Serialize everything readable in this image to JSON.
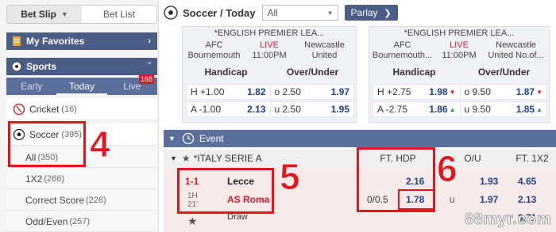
{
  "bet_tabs": {
    "bet_slip": "Bet Slip",
    "bet_list": "Bet List"
  },
  "favorites": {
    "label": "My Favorites"
  },
  "sports": {
    "label": "Sports"
  },
  "subtabs": {
    "early": "Early",
    "today": "Today",
    "live": "Live",
    "live_count": "168"
  },
  "categories": [
    {
      "label": "Cricket",
      "count": "(16)",
      "icon": "cricket-icon"
    },
    {
      "label": "Soccer",
      "count": "(395)",
      "icon": "soccer-ball-icon"
    }
  ],
  "soccer_sub": [
    {
      "label": "All",
      "count": "(350)"
    },
    {
      "label": "1X2",
      "count": "(266)"
    },
    {
      "label": "Correct Score",
      "count": "(226)"
    },
    {
      "label": "Odd/Even",
      "count": "(257)"
    }
  ],
  "annotations": {
    "n4": "4",
    "n5": "5",
    "n6": "6"
  },
  "topbar": {
    "title": "Soccer / Today",
    "filter": "All",
    "parlay": "Parlay"
  },
  "cards": [
    {
      "league": "*ENGLISH PREMIER LEA...",
      "home": "AFC Bournemouth",
      "home_l1": "AFC",
      "home_l2": "Bournemouth",
      "live": "LIVE",
      "time": "11:00PM",
      "away_l1": "Newcastle",
      "away_l2": "United",
      "handicap": "Handicap",
      "over_under": "Over/Under",
      "rows": [
        {
          "h_lbl": "H +1.00",
          "h_val": "1.82",
          "h_arrow": "",
          "ou_lbl": "o 2.50",
          "ou_val": "1.97",
          "ou_arrow": ""
        },
        {
          "h_lbl": "A -1.00",
          "h_val": "2.13",
          "h_arrow": "",
          "ou_lbl": "u 2.50",
          "ou_val": "1.95",
          "ou_arrow": ""
        }
      ]
    },
    {
      "league": "*ENGLISH PREMIER LEA...",
      "home_l1": "AFC",
      "home_l2": "Bournemouth...",
      "live": "LIVE",
      "time": "11:00PM",
      "away_l1": "Newcastle",
      "away_l2": "United No.of...",
      "handicap": "Handicap",
      "over_under": "Over/Under",
      "rows": [
        {
          "h_lbl": "H +2.75",
          "h_val": "1.98",
          "h_arrow": "down",
          "ou_lbl": "o 9.50",
          "ou_val": "1.87",
          "ou_arrow": "down"
        },
        {
          "h_lbl": "A -2.75",
          "h_val": "1.86",
          "h_arrow": "up",
          "ou_lbl": "u 9.50",
          "ou_val": "1.85",
          "ou_arrow": "up"
        }
      ]
    }
  ],
  "event": {
    "header": "Event",
    "league": "*ITALY SERIE A",
    "col_hdp": "FT. HDP",
    "col_ou": "O/U",
    "col_1x2": "FT. 1X2",
    "match": {
      "score": "1-1",
      "period": "1H",
      "minute": "21'",
      "home": "Lecce",
      "away": "AS Roma",
      "draw": "Draw",
      "hdp_line": "0/0.5",
      "hdp_home": "2.16",
      "hdp_away": "1.78",
      "ou_home_line": "",
      "ou_home": "1.93",
      "ou_away_line": "u",
      "ou_away": "1.97",
      "x_home": "4.65",
      "x_away": "2.13",
      "x_draw": "3.71"
    }
  },
  "watermark": "88myr.com",
  "colors": {
    "nav": "#4a5d85",
    "accent_red": "#e8141c",
    "odds_blue": "#1f3f8a",
    "live_red": "#d0192b"
  }
}
